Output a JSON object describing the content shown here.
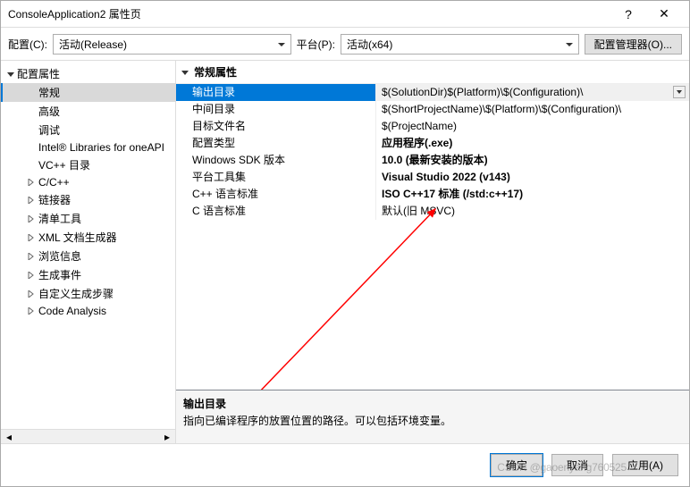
{
  "window": {
    "title": "ConsoleApplication2 属性页",
    "help": "?",
    "close": "✕"
  },
  "toolbar": {
    "config_label": "配置(C):",
    "config_value": "活动(Release)",
    "platform_label": "平台(P):",
    "platform_value": "活动(x64)",
    "manager": "配置管理器(O)..."
  },
  "tree": {
    "root": "配置属性",
    "items": [
      {
        "label": "常规",
        "selected": true
      },
      {
        "label": "高级"
      },
      {
        "label": "调试"
      },
      {
        "label": "Intel® Libraries for oneAPI"
      },
      {
        "label": "VC++ 目录"
      },
      {
        "label": "C/C++",
        "expandable": true
      },
      {
        "label": "链接器",
        "expandable": true
      },
      {
        "label": "清单工具",
        "expandable": true
      },
      {
        "label": "XML 文档生成器",
        "expandable": true
      },
      {
        "label": "浏览信息",
        "expandable": true
      },
      {
        "label": "生成事件",
        "expandable": true
      },
      {
        "label": "自定义生成步骤",
        "expandable": true
      },
      {
        "label": "Code Analysis",
        "expandable": true
      }
    ]
  },
  "props": {
    "header": "常规属性",
    "rows": [
      {
        "key": "输出目录",
        "val": "$(SolutionDir)$(Platform)\\$(Configuration)\\",
        "selected": true
      },
      {
        "key": "中间目录",
        "val": "$(ShortProjectName)\\$(Platform)\\$(Configuration)\\"
      },
      {
        "key": "目标文件名",
        "val": "$(ProjectName)"
      },
      {
        "key": "配置类型",
        "val": "应用程序(.exe)",
        "bold": true
      },
      {
        "key": "Windows SDK 版本",
        "val": "10.0 (最新安装的版本)",
        "bold": true
      },
      {
        "key": "平台工具集",
        "val": "Visual Studio 2022 (v143)",
        "bold": true
      },
      {
        "key": "C++ 语言标准",
        "val": "ISO C++17 标准 (/std:c++17)",
        "bold": true
      },
      {
        "key": "C 语言标准",
        "val": "默认(旧 MSVC)"
      }
    ]
  },
  "desc": {
    "title": "输出目录",
    "text": "指向已编译程序的放置位置的路径。可以包括环境变量。"
  },
  "footer": {
    "ok": "确定",
    "cancel": "取消",
    "apply": "应用(A)"
  },
  "watermark": "CSDN @gaoenyang760525"
}
